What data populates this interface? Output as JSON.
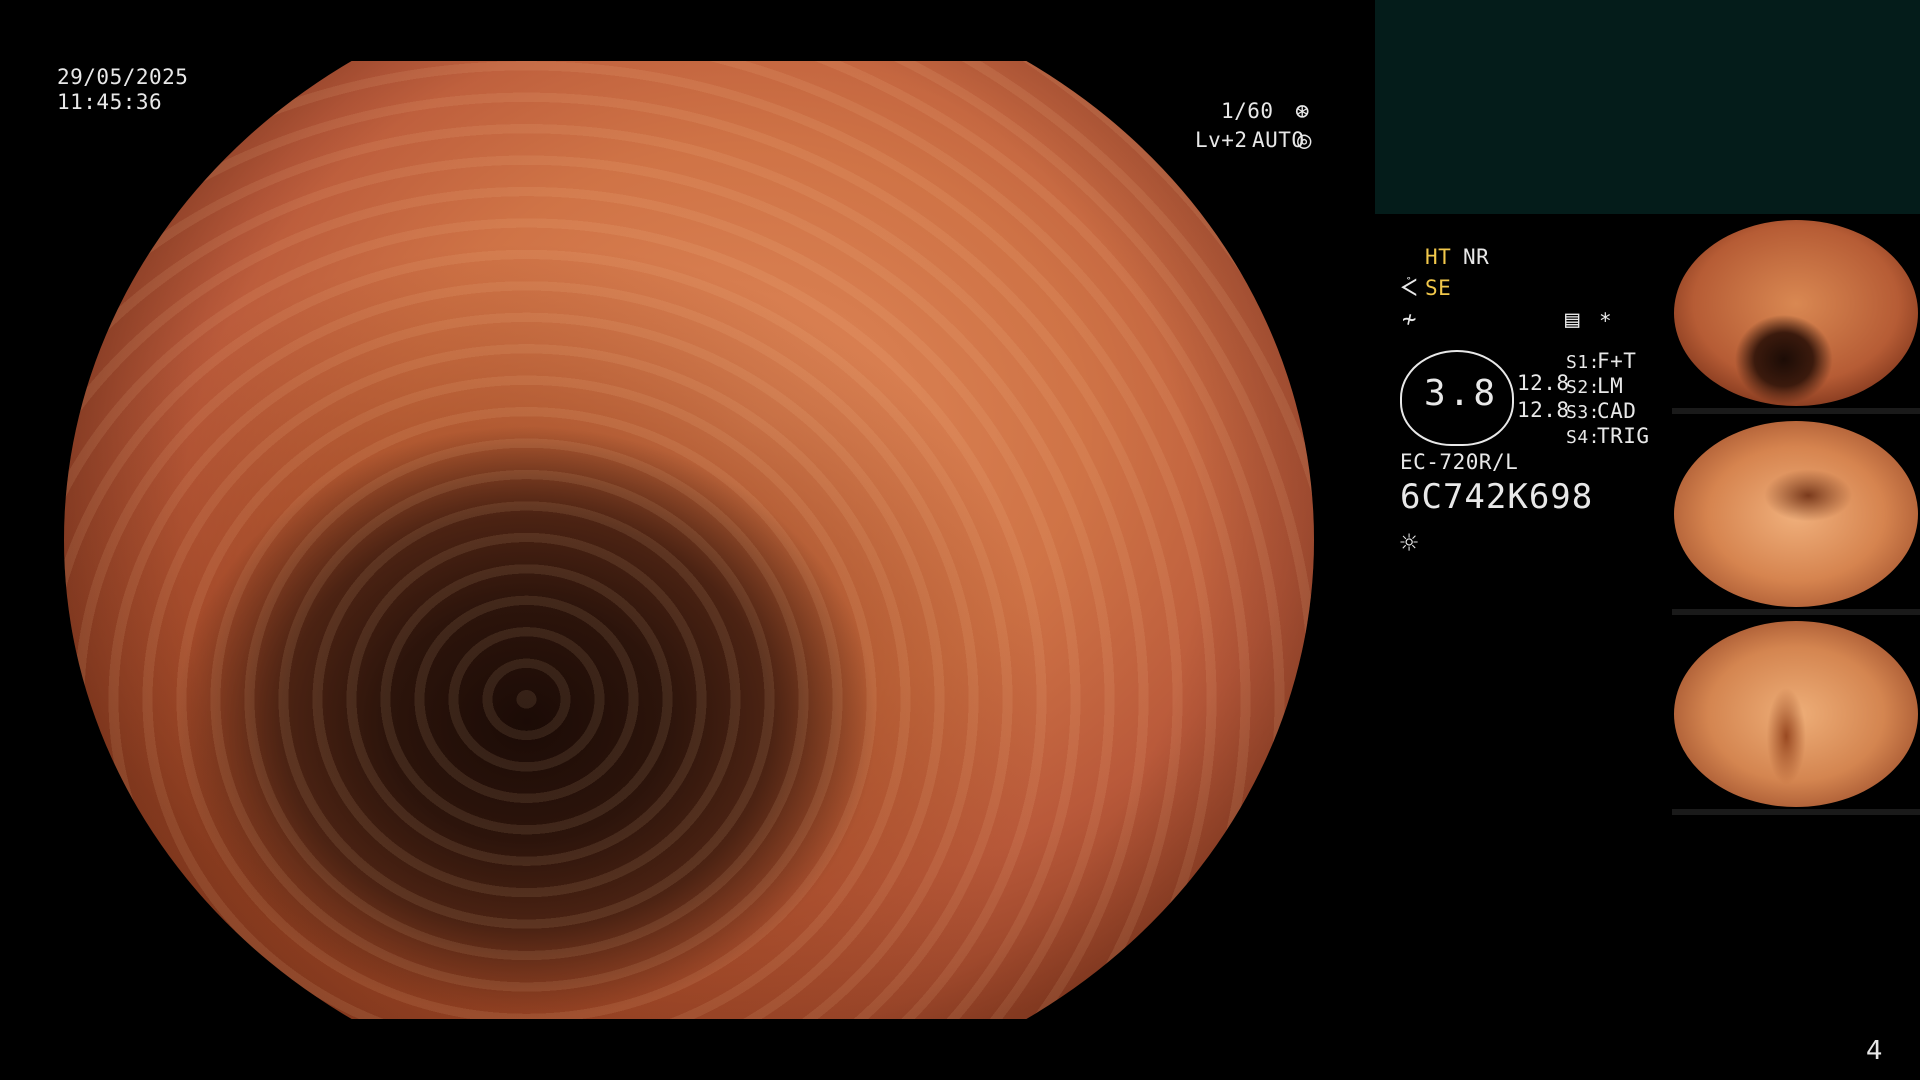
{
  "overlay": {
    "date": "29/05/2025",
    "time": "11:45:36",
    "shutter": "1/60",
    "level": "Lv+2",
    "mode": "AUTO"
  },
  "status": {
    "ht": "HT",
    "nr": "NR",
    "se": "SE",
    "gauge_value": "3.8",
    "val_1": "12.8",
    "val_2": "12.8",
    "s1_key": "S1:",
    "s1_val": "F+T",
    "s2_key": "S2:",
    "s2_val": "LM",
    "s3_key": "S3:",
    "s3_val": "CAD",
    "s4_key": "S4:",
    "s4_val": "TRIG",
    "scope_model": "EC-720R/L",
    "serial": "6C742K698",
    "asterisk": "*"
  },
  "icons": {
    "shutter": "aperture-icon",
    "auto": "auto-exposure-icon",
    "se": "structure-enhance-icon",
    "color": "color-tone-icon",
    "record": "record-icon",
    "light": "light-icon"
  },
  "thumbnails": [
    "thumbnail-1",
    "thumbnail-2",
    "thumbnail-3"
  ],
  "page_number": "4"
}
